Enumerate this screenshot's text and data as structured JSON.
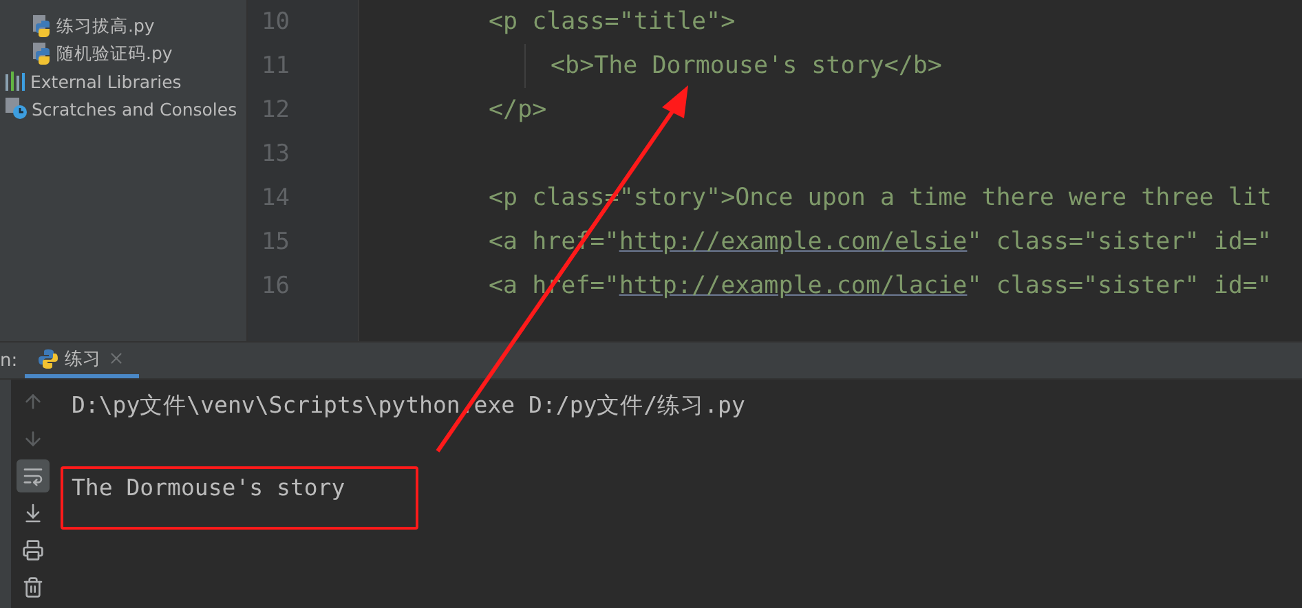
{
  "project_tree": [
    {
      "label": "练习拔高.py",
      "kind": "python"
    },
    {
      "label": "随机验证码.py",
      "kind": "python"
    },
    {
      "label": "External Libraries",
      "kind": "library"
    },
    {
      "label": "Scratches and Consoles",
      "kind": "scratches"
    }
  ],
  "editor": {
    "lines": [
      {
        "number": "10",
        "indented": false,
        "segments": [
          {
            "text": "<p class=\"title\">",
            "link": false
          }
        ]
      },
      {
        "number": "11",
        "indented": true,
        "segments": [
          {
            "text": "<b>The Dormouse's story</b>",
            "link": false
          }
        ]
      },
      {
        "number": "12",
        "indented": false,
        "segments": [
          {
            "text": "</p>",
            "link": false
          }
        ]
      },
      {
        "number": "13",
        "indented": false
      },
      {
        "number": "14",
        "indented": false,
        "segments": [
          {
            "text": "<p class=\"story\">Once upon a time there were three lit",
            "link": false
          }
        ]
      },
      {
        "number": "15",
        "indented": false,
        "segments": [
          {
            "text": "<a href=\"",
            "link": false
          },
          {
            "text": "http://example.com/elsie",
            "link": true
          },
          {
            "text": "\" class=\"sister\" id=\"",
            "link": false
          }
        ]
      },
      {
        "number": "16",
        "indented": false,
        "segments": [
          {
            "text": "<a href=\"",
            "link": false
          },
          {
            "text": "http://example.com/lacie",
            "link": true
          },
          {
            "text": "\" class=\"sister\" id=\"",
            "link": false
          }
        ]
      }
    ]
  },
  "run_panel": {
    "label": "n:",
    "tabs": [
      {
        "label": "练习",
        "selected": true
      }
    ],
    "toolbar": [
      {
        "kind": "up",
        "disabled": true,
        "selected": false
      },
      {
        "kind": "down",
        "disabled": true,
        "selected": false
      },
      {
        "kind": "wrap",
        "disabled": false,
        "selected": true
      },
      {
        "kind": "scroll-end",
        "disabled": false,
        "selected": false
      },
      {
        "kind": "print",
        "disabled": false,
        "selected": false
      },
      {
        "kind": "trash",
        "disabled": false,
        "selected": false
      }
    ],
    "console": [
      {
        "text": "D:\\py文件\\venv\\Scripts\\python.exe D:/py文件/练习.py",
        "boxed": false
      },
      {
        "boxed": false
      },
      {
        "text": "The Dormouse's story",
        "boxed": true
      }
    ]
  }
}
